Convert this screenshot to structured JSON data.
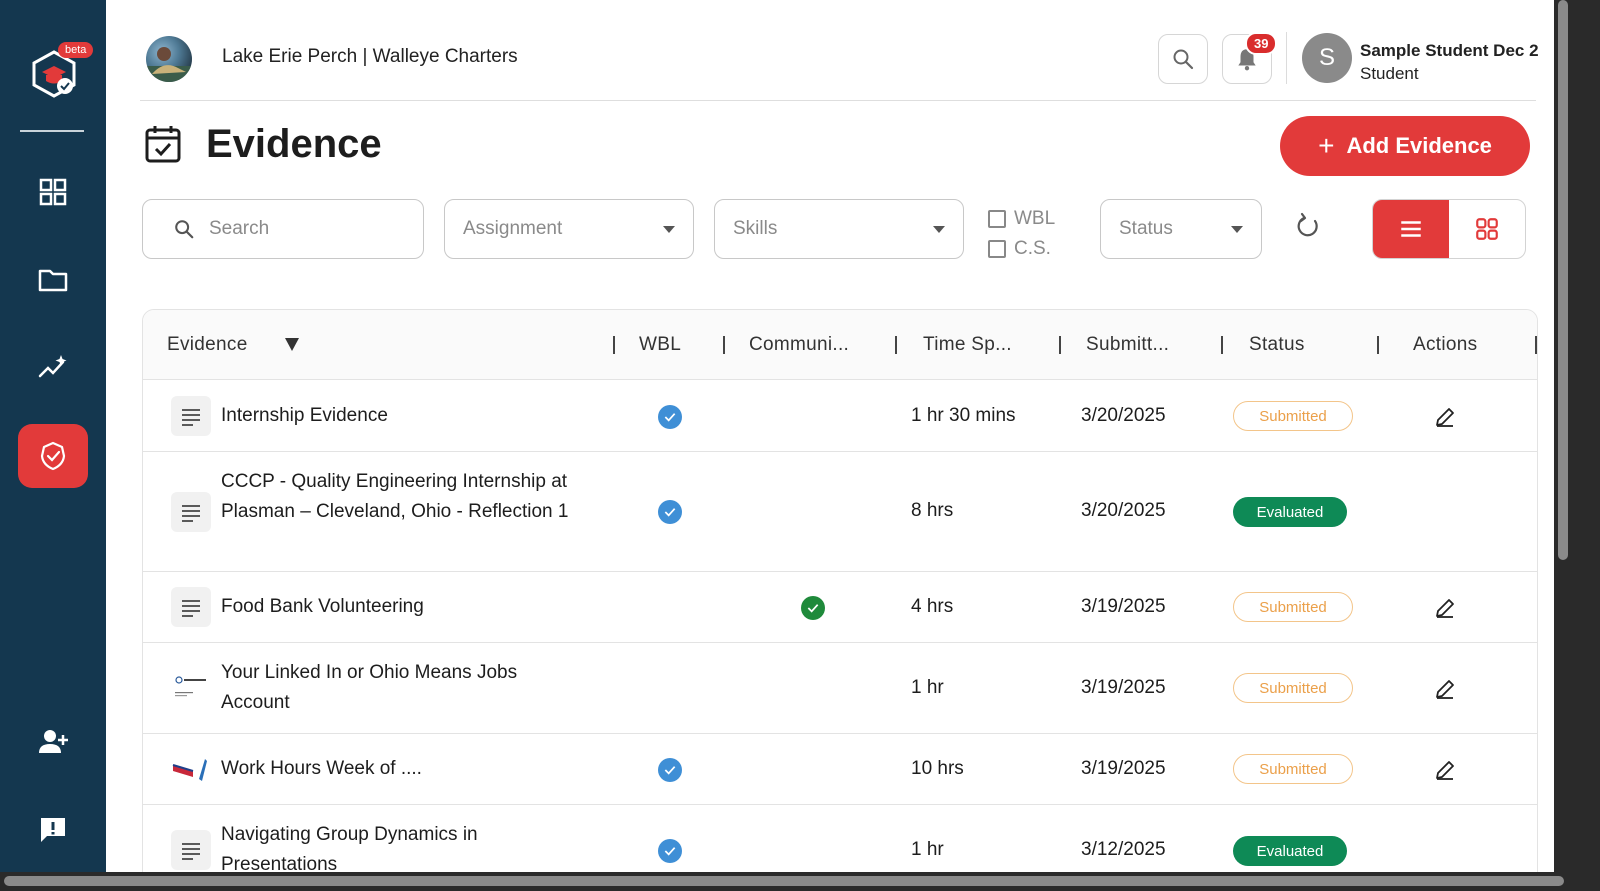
{
  "sidebar": {
    "beta_label": "beta",
    "items": [
      {
        "name": "dashboard",
        "icon": "grid-icon"
      },
      {
        "name": "portfolio",
        "icon": "folder-icon"
      },
      {
        "name": "analytics",
        "icon": "trend-sparkle-icon"
      },
      {
        "name": "evidence",
        "icon": "evidence-badge-icon",
        "active": true
      },
      {
        "name": "add-user",
        "icon": "add-user-icon"
      },
      {
        "name": "feedback",
        "icon": "chat-alert-icon"
      }
    ]
  },
  "header": {
    "title": "Lake Erie Perch | Walleye Charters",
    "notification_count": "39",
    "user_initial": "S",
    "user_name": "Sample Student Dec 2",
    "user_role": "Student"
  },
  "page": {
    "title": "Evidence",
    "add_button": "Add Evidence",
    "add_button_plus": "+"
  },
  "filters": {
    "search_placeholder": "Search",
    "assignment_placeholder": "Assignment",
    "skills_placeholder": "Skills",
    "wbl_label": "WBL",
    "cs_label": "C.S.",
    "status_placeholder": "Status"
  },
  "table": {
    "columns": [
      "Evidence",
      "WBL",
      "Communi...",
      "Time Sp...",
      "Submitt...",
      "Status",
      "Actions"
    ],
    "rows": [
      {
        "title": "Internship Evidence",
        "wbl": true,
        "community": false,
        "time": "1 hr 30 mins",
        "date": "3/20/2025",
        "status": "Submitted",
        "editable": true,
        "icon": "text-lines-icon"
      },
      {
        "title": "CCCP - Quality Engineering Internship at Plasman – Cleveland, Ohio - Reflection 1",
        "wbl": true,
        "community": false,
        "time": "8 hrs",
        "date": "3/20/2025",
        "status": "Evaluated",
        "editable": false,
        "icon": "text-lines-icon"
      },
      {
        "title": "Food Bank Volunteering",
        "wbl": false,
        "community": true,
        "time": "4 hrs",
        "date": "3/19/2025",
        "status": "Submitted",
        "editable": true,
        "icon": "text-lines-icon"
      },
      {
        "title": "Your Linked In or Ohio Means Jobs Account",
        "wbl": false,
        "community": false,
        "time": "1 hr",
        "date": "3/19/2025",
        "status": "Submitted",
        "editable": true,
        "icon": "document-thumbnail-icon"
      },
      {
        "title": "Work Hours Week of ....",
        "wbl": true,
        "community": false,
        "time": "10 hrs",
        "date": "3/19/2025",
        "status": "Submitted",
        "editable": true,
        "icon": "image-thumbnail-icon"
      },
      {
        "title": "Navigating Group Dynamics in Presentations",
        "wbl": true,
        "community": false,
        "time": "1 hr",
        "date": "3/12/2025",
        "status": "Evaluated",
        "editable": false,
        "icon": "text-lines-icon"
      }
    ]
  },
  "colors": {
    "sidebar_bg": "#14374f",
    "accent_red": "#e23a3a",
    "wbl_check": "#3f8fd6",
    "community_check": "#1f8a3b",
    "submitted": "#eba04a",
    "evaluated": "#0e8a56"
  }
}
